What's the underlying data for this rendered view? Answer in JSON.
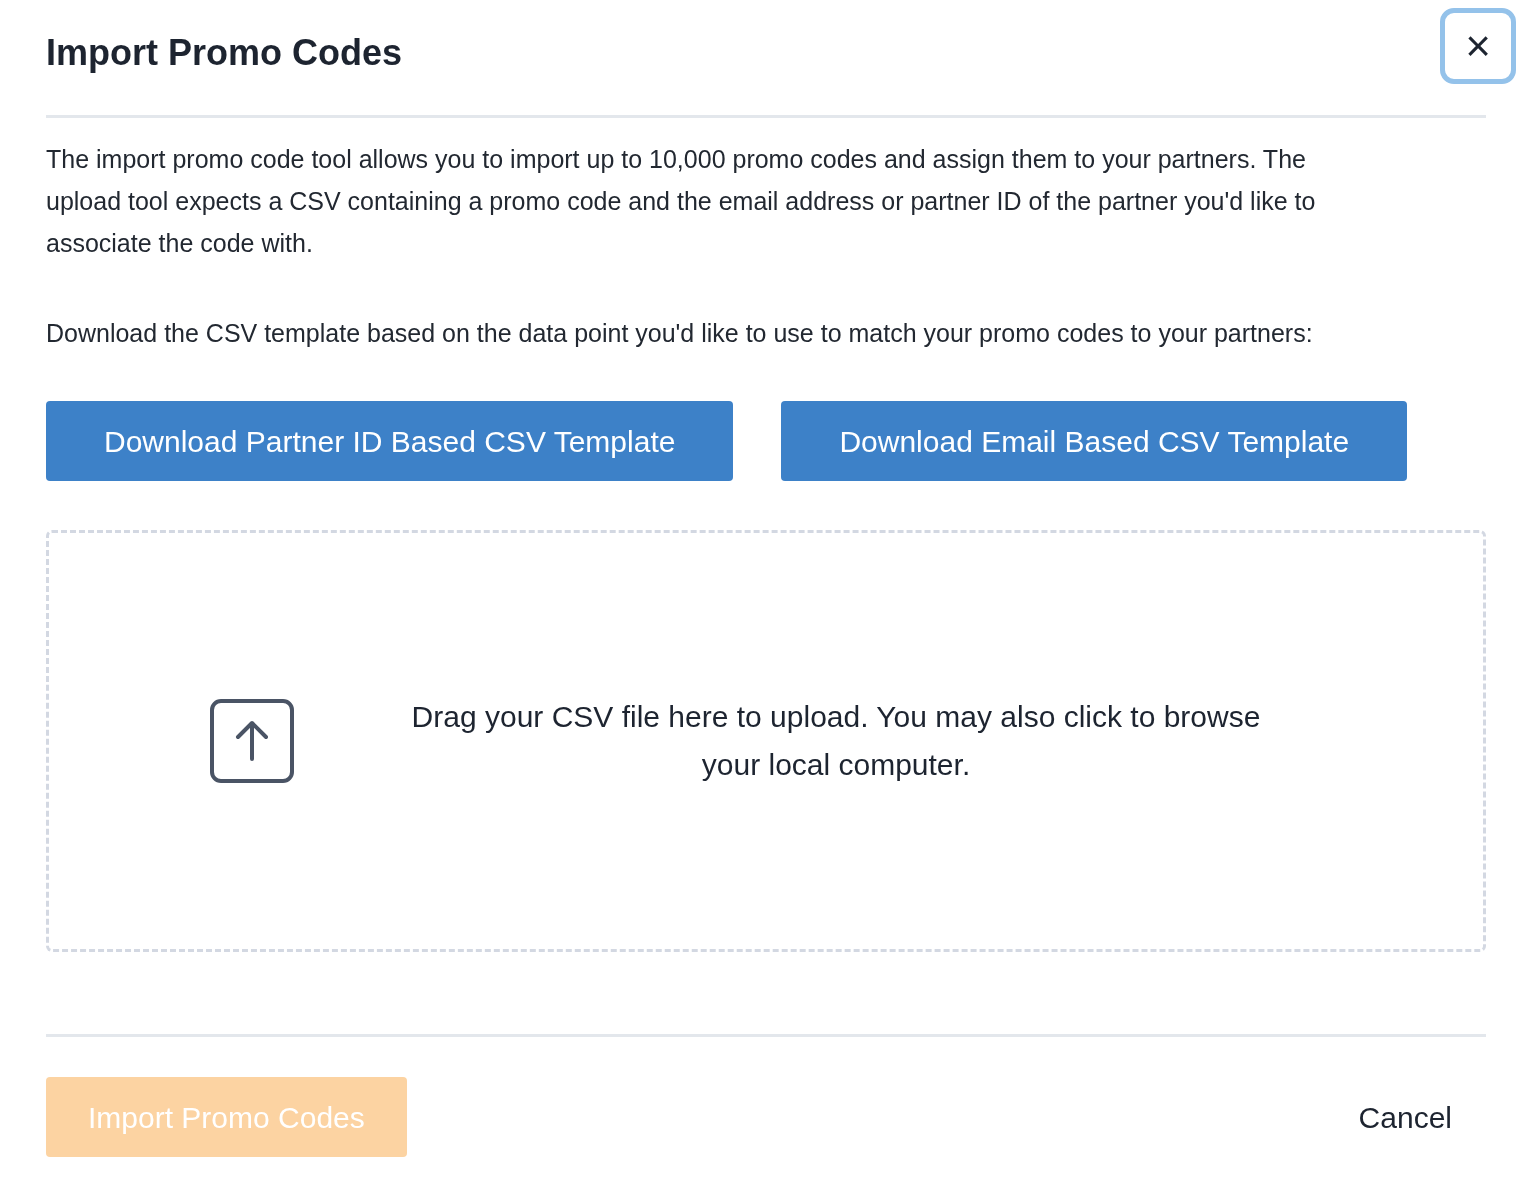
{
  "dialog": {
    "title": "Import Promo Codes",
    "close_button": {
      "label": "×",
      "focused": true
    }
  },
  "description": [
    "The import promo code tool allows you to import up to 10,000 promo codes and assign them to your partners. The upload tool expects a CSV containing a promo code and the email address or partner ID of the partner you'd like to associate the code with.",
    "Download the CSV template based on the data point you'd like to use to match your promo codes to your partners:"
  ],
  "template_buttons": [
    {
      "label": "Download Partner ID Based CSV Template"
    },
    {
      "label": "Download Email Based CSV Template"
    }
  ],
  "dropzone": {
    "text": "Drag your CSV file here to upload. You may also click to browse your local computer."
  },
  "footer": {
    "primary_button": {
      "label": "Import Promo Codes",
      "disabled": true
    },
    "cancel_button": {
      "label": "Cancel"
    }
  }
}
